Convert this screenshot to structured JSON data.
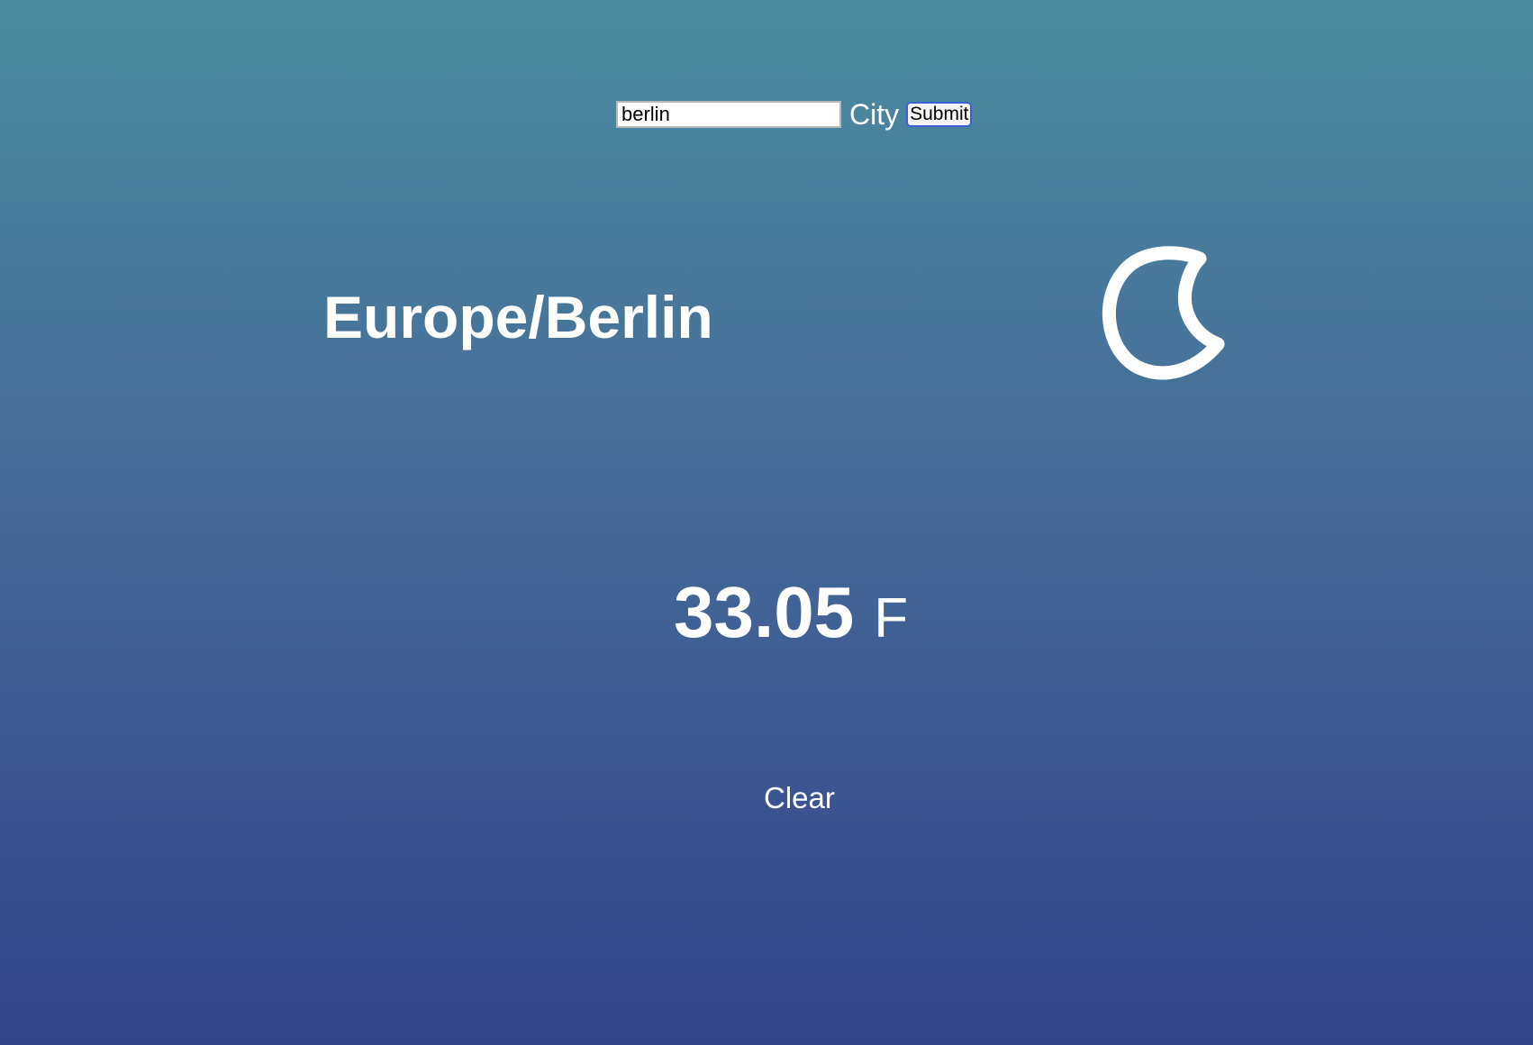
{
  "search": {
    "input_value": "berlin",
    "label": "City",
    "submit_label": "Submit"
  },
  "location": {
    "timezone": "Europe/Berlin"
  },
  "weather": {
    "icon": "moon-icon",
    "temperature": "33.05",
    "unit": "F"
  },
  "actions": {
    "clear_label": "Clear"
  },
  "colors": {
    "background_top": "#4b8ca1",
    "background_bottom": "#34428a",
    "text": "#ffffff",
    "submit_border": "#3a62d6"
  }
}
